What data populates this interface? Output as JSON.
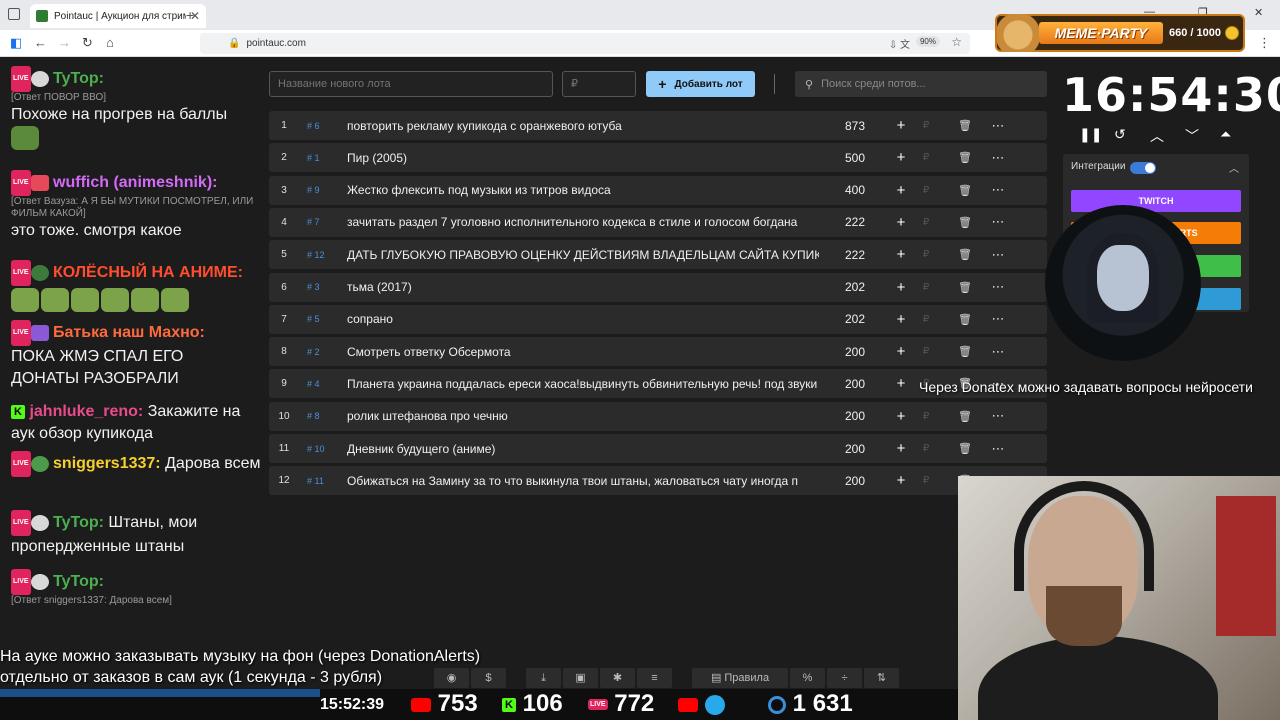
{
  "browser": {
    "tab_title": "Pointauc | Аукцион для стриме",
    "url": "pointauc.com",
    "zoom": "90%"
  },
  "memeparty": {
    "title": "MEME·PARTY",
    "count": "660 / 1000"
  },
  "chat": {
    "messages": [
      {
        "nick": "TyTop:",
        "nick_color": "#4caf50",
        "reply": "[Ответ ПОВОР ВВО]",
        "text": "Похоже на прогрев на баллы"
      },
      {
        "nick": "wuffich (animeshnik):",
        "nick_color": "#d36af7",
        "reply": "[Ответ Вазуза: А Я БЫ МУТИКИ ПОСМОТРЕЛ, ИЛИ ФИЛЬМ КАКОЙ]",
        "text": "это тоже. смотря какое"
      },
      {
        "nick": "КОЛЁСНЫЙ НА АНИМЕ:",
        "nick_color": "#ff4d2e",
        "reply": "",
        "text": ""
      },
      {
        "nick": "Батька наш Махно:",
        "nick_color": "#ff6a3d",
        "reply": "",
        "text": "ПОКА ЖМЭ СПАЛ ЕГО ДОНАТЫ РАЗОБРАЛИ"
      },
      {
        "nick": "jahnluke_reno:",
        "nick_color": "#e94c8c",
        "reply": "",
        "text": "Закажите на аук обзор купикода"
      },
      {
        "nick": "sniggers1337:",
        "nick_color": "#f7d02c",
        "reply": "",
        "text": "Дарова всем"
      },
      {
        "nick": "TyTop:",
        "nick_color": "#4caf50",
        "reply": "",
        "text": "Штаны, мои пропердженные штаны"
      },
      {
        "nick": "TyTop:",
        "nick_color": "#4caf50",
        "reply": "[Ответ sniggers1337: Дарова всем]",
        "text": ""
      }
    ]
  },
  "auction": {
    "lot_placeholder": "Название нового лота",
    "price_placeholder": "₽",
    "add_label": "Добавить лот",
    "search_placeholder": "Поиск среди потов...",
    "lots": [
      {
        "idx": "1",
        "fast": "# 6",
        "name": "повторить рекламу купикода с оранжевого ютуба",
        "amount": "873"
      },
      {
        "idx": "2",
        "fast": "# 1",
        "name": "Пир (2005)",
        "amount": "500"
      },
      {
        "idx": "3",
        "fast": "# 9",
        "name": "Жестко флексить под музыки из титров видоса",
        "amount": "400"
      },
      {
        "idx": "4",
        "fast": "# 7",
        "name": "зачитать раздел 7 уголовно исполнительного кодекса в стиле и голосом богдана",
        "amount": "222"
      },
      {
        "idx": "5",
        "fast": "# 12",
        "name": "ДАТЬ ГЛУБОКУЮ ПРАВОВУЮ ОЦЕНКУ ДЕЙСТВИЯМ ВЛАДЕЛЬЦАМ САЙТА КУПИКОДА",
        "amount": "222"
      },
      {
        "idx": "6",
        "fast": "# 3",
        "name": "тьма (2017)",
        "amount": "202"
      },
      {
        "idx": "7",
        "fast": "# 5",
        "name": "сопрано",
        "amount": "202"
      },
      {
        "idx": "8",
        "fast": "# 2",
        "name": "Смотреть ответку Обсермота",
        "amount": "200"
      },
      {
        "idx": "9",
        "fast": "# 4",
        "name": "Планета украина поддалась ереси хаоса!выдвинуть обвинительную речь! под звуки",
        "amount": "200"
      },
      {
        "idx": "10",
        "fast": "# 8",
        "name": " ролик штефанова про чечню",
        "amount": "200"
      },
      {
        "idx": "11",
        "fast": "# 10",
        "name": "Дневник будущего (аниме)",
        "amount": "200"
      },
      {
        "idx": "12",
        "fast": "# 11",
        "name": "Обижаться на Замину за то что выкинула твои штаны, жаловаться чату иногда п",
        "amount": "200"
      }
    ]
  },
  "timer": {
    "value": "16:54:30",
    "integrations_label": "Интеграции",
    "buttons": [
      {
        "label": "TWITCH",
        "color": "#9147ff"
      },
      {
        "label": "DONATIONALERTS",
        "color": "#f57d07"
      },
      {
        "label": "",
        "color": "#3fbf4a"
      },
      {
        "label": "",
        "color": "#2e9bd6"
      }
    ]
  },
  "overlay": {
    "donatex_text": "Через Donatex можно задавать вопросы нейросети",
    "info_line1": "На ауке можно заказывать музыку на фон (через DonationAlerts)",
    "info_line2": "отдельно от заказов в сам аук (1 секунда - 3 рубля)"
  },
  "toolbar": {
    "rules_label": "Правила",
    "percent_label": "%"
  },
  "stats": {
    "clock": "15:52:39",
    "youtube": "753",
    "kick": "106",
    "vk": "772",
    "viewers": "1 631"
  }
}
